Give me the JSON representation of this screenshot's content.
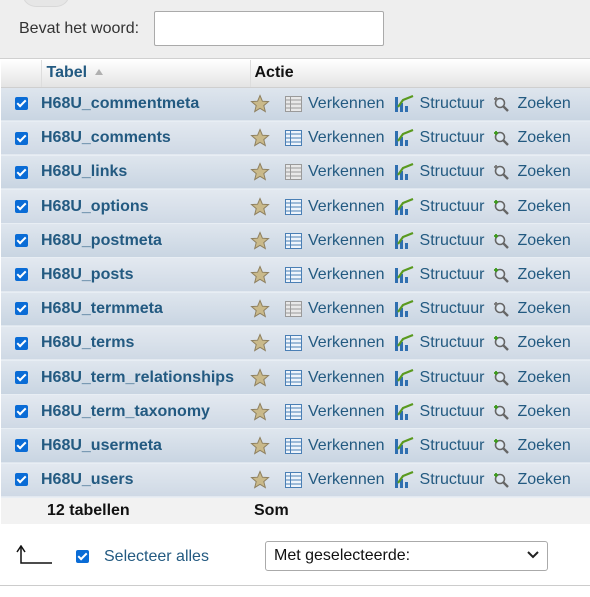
{
  "filter": {
    "label": "Bevat het woord:",
    "value": ""
  },
  "table": {
    "headers": {
      "name": "Tabel",
      "action": "Actie"
    },
    "action_labels": {
      "browse": "Verkennen",
      "structure": "Structuur",
      "search": "Zoeken"
    },
    "rows": [
      {
        "name": "H68U_commentmeta",
        "checked": true,
        "empty": true
      },
      {
        "name": "H68U_comments",
        "checked": true,
        "empty": false
      },
      {
        "name": "H68U_links",
        "checked": true,
        "empty": true
      },
      {
        "name": "H68U_options",
        "checked": true,
        "empty": false
      },
      {
        "name": "H68U_postmeta",
        "checked": true,
        "empty": false
      },
      {
        "name": "H68U_posts",
        "checked": true,
        "empty": false
      },
      {
        "name": "H68U_termmeta",
        "checked": true,
        "empty": true
      },
      {
        "name": "H68U_terms",
        "checked": true,
        "empty": false
      },
      {
        "name": "H68U_term_relationships",
        "checked": true,
        "empty": false
      },
      {
        "name": "H68U_term_taxonomy",
        "checked": true,
        "empty": false
      },
      {
        "name": "H68U_usermeta",
        "checked": true,
        "empty": false
      },
      {
        "name": "H68U_users",
        "checked": true,
        "empty": false
      }
    ],
    "footer": {
      "count": "12 tabellen",
      "sum": "Som"
    }
  },
  "bulk": {
    "select_all_label": "Selecteer alles",
    "select_all_checked": true,
    "with_selected": "Met geselecteerde:"
  },
  "colors": {
    "link": "#235a81",
    "checkbox": "#0a6cd6",
    "row": "#d3dde8"
  }
}
